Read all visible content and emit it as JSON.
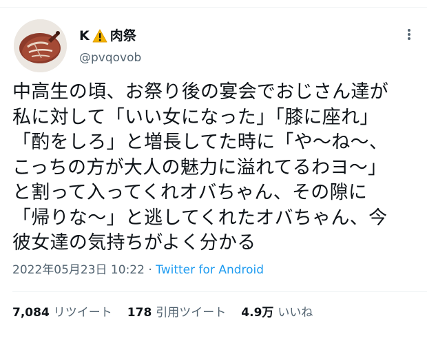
{
  "user": {
    "name_part1": "K",
    "name_icon": "warning-icon",
    "name_part2": "肉祭",
    "handle": "@pvqovob"
  },
  "tweet": {
    "lines": [
      "中高生の頃、お祭り後の宴会でおじさん達が",
      "私に対して「いい女になった」「膝に座れ」",
      "「酌をしろ」と増長してた時に「や〜ね〜、",
      "こっちの方が大人の魅力に溢れてるわヨ〜」",
      "と割って入ってくれオバちゃん、その隙に",
      "「帰りな〜」と逃してくれたオバちゃん、今",
      "彼女達の気持ちがよく分かる"
    ],
    "timestamp": "2022年05月23日 10:22",
    "separator": "·",
    "source": "Twitter for Android"
  },
  "stats": {
    "retweets_count": "7,084",
    "retweets_label": "リツイート",
    "quotes_count": "178",
    "quotes_label": "引用ツイート",
    "likes_count": "4.9万",
    "likes_label": "いいね"
  },
  "colors": {
    "text": "#0f1419",
    "secondary": "#536471",
    "link": "#1d9bf0",
    "warning": "#f4b400"
  }
}
